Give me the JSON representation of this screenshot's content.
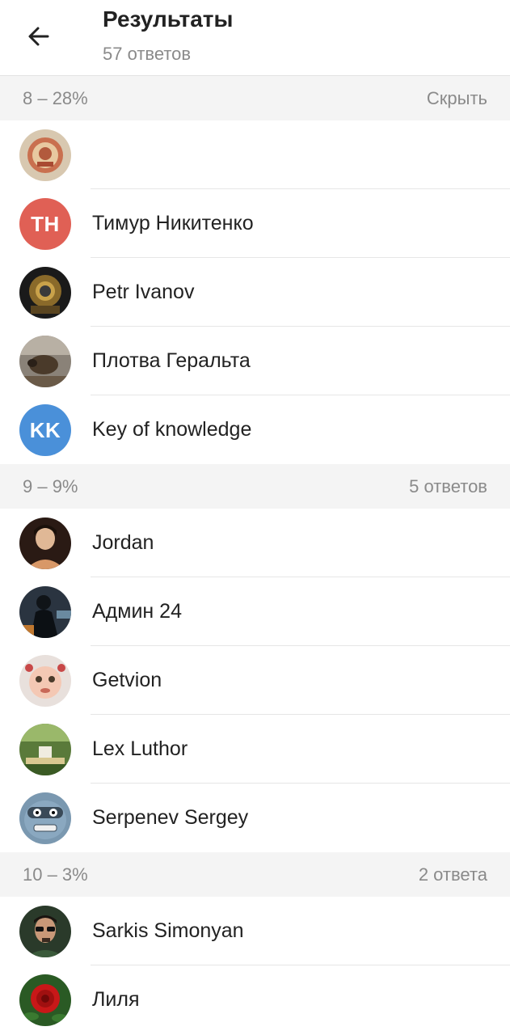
{
  "header": {
    "title": "Результаты",
    "subtitle": "57 ответов"
  },
  "sections": [
    {
      "title": "8 – 28%",
      "right": "Скрыть",
      "rows": [
        {
          "name": "",
          "avatar": "badge-photo"
        },
        {
          "name": "Тимур Никитенко",
          "avatar": "initials",
          "initials": "ТН",
          "color": "#e06055"
        },
        {
          "name": "Petr Ivanov",
          "avatar": "diver-helmet-photo"
        },
        {
          "name": "Плотва Геральта",
          "avatar": "horse-photo"
        },
        {
          "name": "Key of knowledge",
          "avatar": "initials",
          "initials": "KK",
          "color": "#4a90d9"
        }
      ]
    },
    {
      "title": "9 – 9%",
      "right": "5 ответов",
      "rows": [
        {
          "name": "Jordan",
          "avatar": "person-photo"
        },
        {
          "name": "Админ 24",
          "avatar": "dark-figure-photo"
        },
        {
          "name": "Getvion",
          "avatar": "doll-photo"
        },
        {
          "name": "Lex Luthor",
          "avatar": "garden-photo"
        },
        {
          "name": "Serpenev Sergey",
          "avatar": "robot-face-photo"
        }
      ]
    },
    {
      "title": "10 – 3%",
      "right": "2 ответа",
      "rows": [
        {
          "name": "Sarkis Simonyan",
          "avatar": "sunglasses-person-photo"
        },
        {
          "name": "Лиля",
          "avatar": "rose-photo"
        }
      ]
    }
  ]
}
